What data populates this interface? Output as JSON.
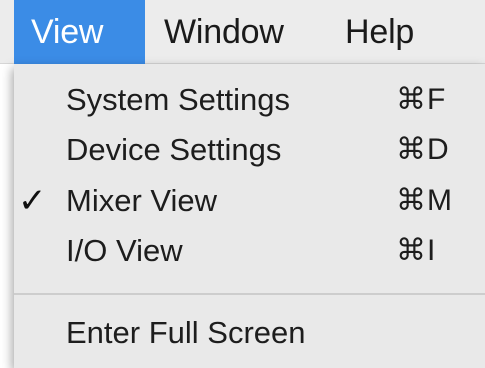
{
  "menubar": {
    "titles": [
      "View",
      "Window",
      "Help"
    ],
    "active_color": "#3b8ce6"
  },
  "dropdown": {
    "items": [
      {
        "label": "System Settings",
        "shortcut": "⌘F",
        "checked": false
      },
      {
        "label": "Device Settings",
        "shortcut": "⌘D",
        "checked": false
      },
      {
        "label": "Mixer View",
        "shortcut": "⌘M",
        "checked": true,
        "check_glyph": "✓"
      },
      {
        "label": "I/O View",
        "shortcut": "⌘I",
        "checked": false
      },
      {
        "label": "Enter Full Screen",
        "checked": false
      }
    ]
  }
}
